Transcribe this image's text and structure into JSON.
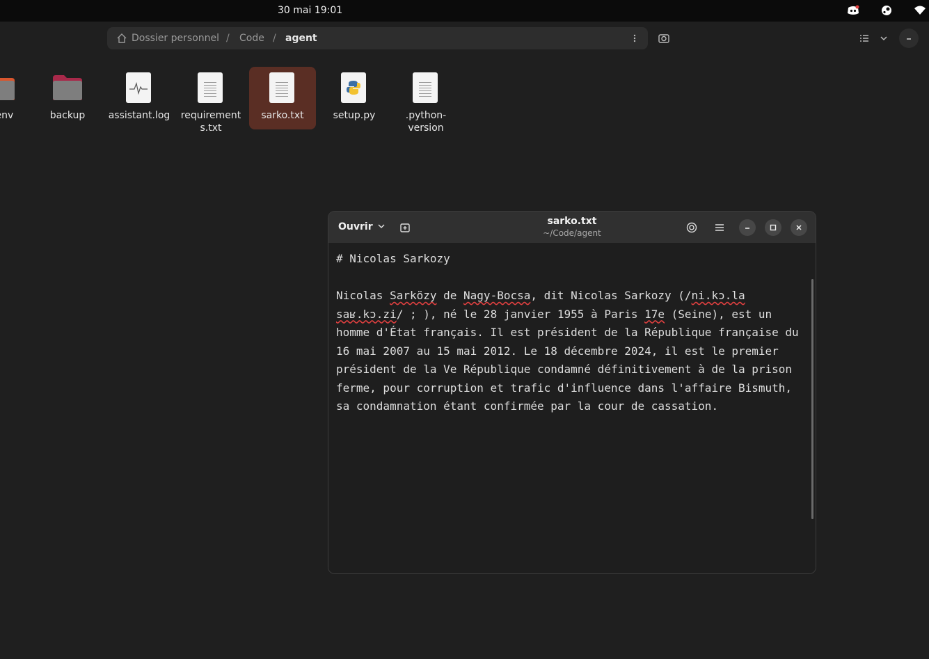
{
  "topbar": {
    "clock": "30 mai  19:01",
    "tray_icons": [
      "discord-icon",
      "steam-icon",
      "wifi-icon"
    ]
  },
  "pathbar": {
    "crumbs": [
      "Dossier personnel",
      "Code",
      "agent"
    ],
    "separator": "/"
  },
  "files": [
    {
      "name": ".venv",
      "type": "folder"
    },
    {
      "name": "backup",
      "type": "folder"
    },
    {
      "name": "assistant.log",
      "type": "log"
    },
    {
      "name": "requirements.txt",
      "line1": "requirement",
      "line2": "s.txt",
      "type": "text"
    },
    {
      "name": "sarko.txt",
      "type": "text",
      "selected": true
    },
    {
      "name": "setup.py",
      "type": "python"
    },
    {
      "name": ".python-version",
      "line1": ".python-",
      "line2": "version",
      "type": "text"
    }
  ],
  "editor": {
    "open_label": "Ouvrir",
    "title": "sarko.txt",
    "subtitle": "~/Code/agent",
    "heading": "# Nicolas Sarkozy",
    "paragraph_parts": [
      "Nicolas ",
      "Sarközy",
      " de ",
      "Nagy-Bocsa",
      ", dit Nicolas Sarkozy (/",
      "ni.kɔ.la",
      "\n",
      "saʁ.kɔ.zi",
      "/ ; ), né le 28 janvier 1955 à Paris ",
      "17e",
      " (Seine), est un homme d'État français. Il est président de la République française du 16 mai 2007 au 15 mai 2012. Le 18 décembre 2024, il est le premier président de la Ve République condamné définitivement à de la prison ferme, pour corruption et trafic d'influence dans l'affaire Bismuth, sa condamnation étant confirmée par la cour de cassation."
    ]
  }
}
